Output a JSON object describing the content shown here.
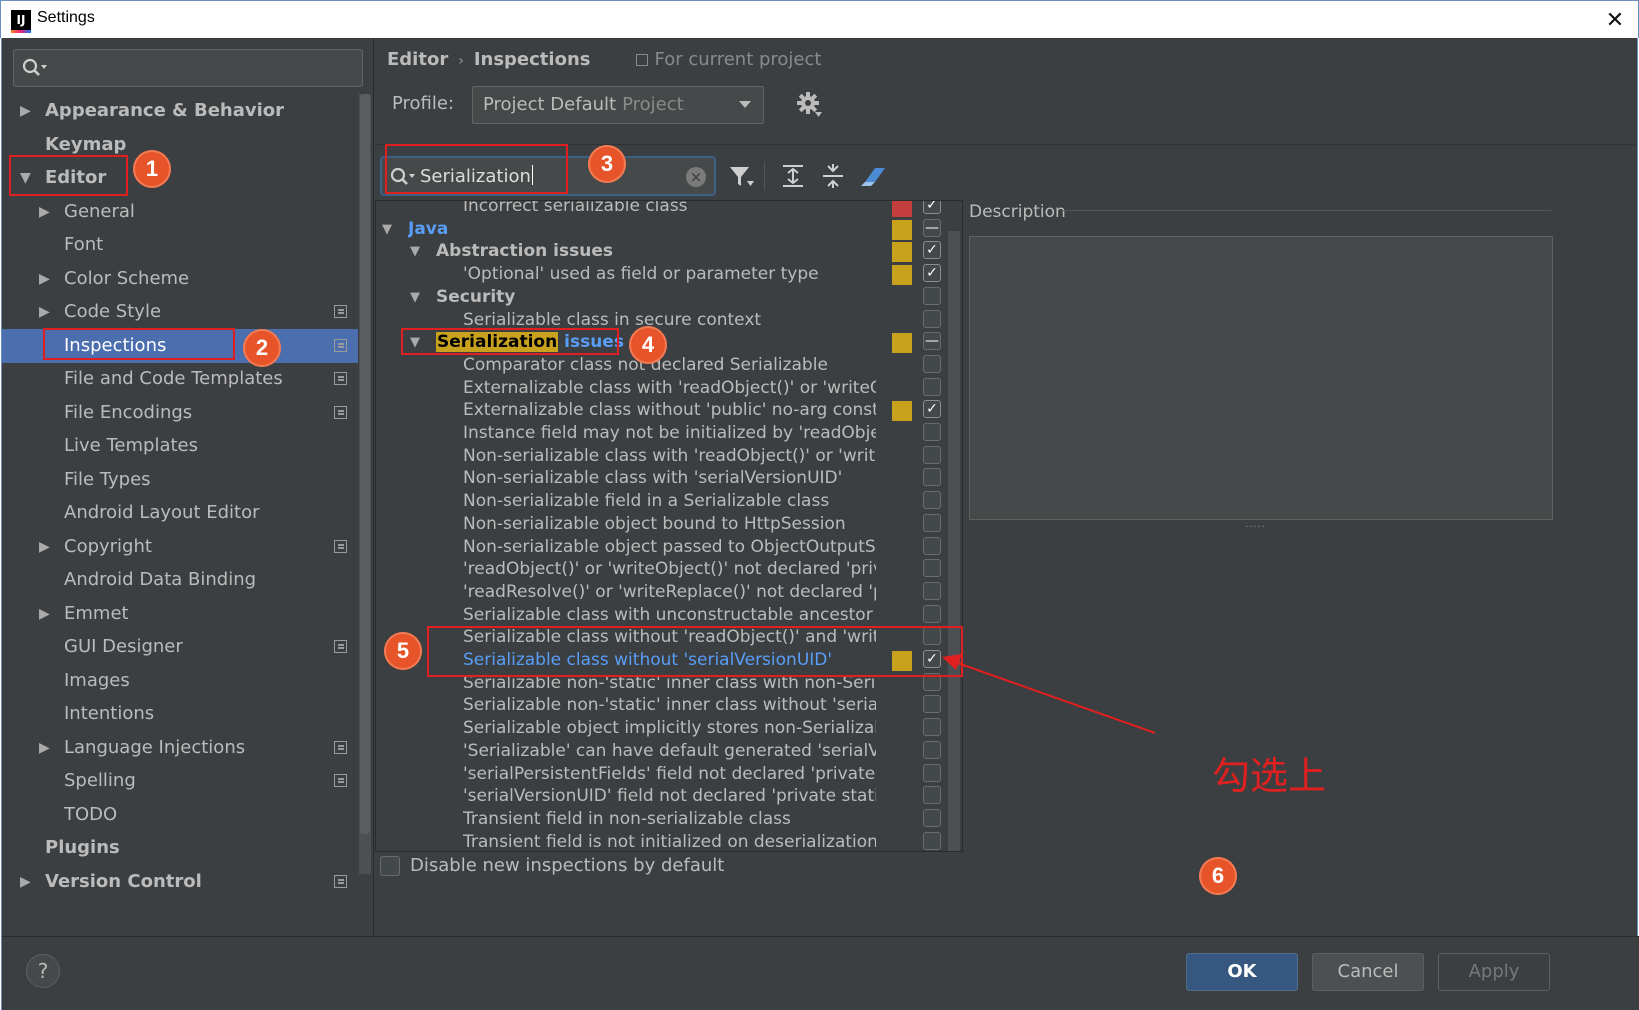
{
  "window": {
    "title": "Settings",
    "close": "✕"
  },
  "sidebar": {
    "items": [
      {
        "label": "Appearance & Behavior",
        "arrow": "▶"
      },
      {
        "label": "Keymap",
        "arrow": ""
      },
      {
        "label": "Editor",
        "arrow": "▼"
      },
      {
        "label": "General",
        "arrow": "▶"
      },
      {
        "label": "Font",
        "arrow": ""
      },
      {
        "label": "Color Scheme",
        "arrow": "▶"
      },
      {
        "label": "Code Style",
        "arrow": "▶"
      },
      {
        "label": "Inspections",
        "arrow": ""
      },
      {
        "label": "File and Code Templates",
        "arrow": ""
      },
      {
        "label": "File Encodings",
        "arrow": ""
      },
      {
        "label": "Live Templates",
        "arrow": ""
      },
      {
        "label": "File Types",
        "arrow": ""
      },
      {
        "label": "Android Layout Editor",
        "arrow": ""
      },
      {
        "label": "Copyright",
        "arrow": "▶"
      },
      {
        "label": "Android Data Binding",
        "arrow": ""
      },
      {
        "label": "Emmet",
        "arrow": "▶"
      },
      {
        "label": "GUI Designer",
        "arrow": ""
      },
      {
        "label": "Images",
        "arrow": ""
      },
      {
        "label": "Intentions",
        "arrow": ""
      },
      {
        "label": "Language Injections",
        "arrow": "▶"
      },
      {
        "label": "Spelling",
        "arrow": ""
      },
      {
        "label": "TODO",
        "arrow": ""
      },
      {
        "label": "Plugins",
        "arrow": ""
      },
      {
        "label": "Version Control",
        "arrow": "▶"
      }
    ]
  },
  "breadcrumb": {
    "parent": "Editor",
    "separator": "›",
    "current": "Inspections",
    "scope": "For current project"
  },
  "profile": {
    "label": "Profile:",
    "value": "Project Default",
    "suffix": "Project"
  },
  "filter": {
    "value": "Serialization"
  },
  "inspections": {
    "rows": [
      {
        "text": "Incorrect serializable class",
        "arrow": ""
      },
      {
        "text": "Java",
        "arrow": "▼"
      },
      {
        "text": "Abstraction issues",
        "arrow": "▼"
      },
      {
        "text": "'Optional' used as field or parameter type",
        "arrow": ""
      },
      {
        "text": "Security",
        "arrow": "▼"
      },
      {
        "text": "Serializable class in secure context",
        "arrow": ""
      },
      {
        "text_hl": "Serialization",
        "text": " issues",
        "arrow": "▼"
      },
      {
        "text": "Comparator class not declared Serializable",
        "arrow": ""
      },
      {
        "text": "Externalizable class with 'readObject()' or 'writeObj",
        "arrow": ""
      },
      {
        "text": "Externalizable class without 'public' no-arg constru",
        "arrow": ""
      },
      {
        "text": "Instance field may not be initialized by 'readObject",
        "arrow": ""
      },
      {
        "text": "Non-serializable class with 'readObject()' or 'writeO",
        "arrow": ""
      },
      {
        "text": "Non-serializable class with 'serialVersionUID'",
        "arrow": ""
      },
      {
        "text": "Non-serializable field in a Serializable class",
        "arrow": ""
      },
      {
        "text": "Non-serializable object bound to HttpSession",
        "arrow": ""
      },
      {
        "text": "Non-serializable object passed to ObjectOutputStr",
        "arrow": ""
      },
      {
        "text": "'readObject()' or 'writeObject()' not declared 'privat",
        "arrow": ""
      },
      {
        "text": "'readResolve()' or 'writeReplace()' not declared 'pro",
        "arrow": ""
      },
      {
        "text": "Serializable class with unconstructable ancestor",
        "arrow": ""
      },
      {
        "text": "Serializable class without 'readObject()' and 'writeC",
        "arrow": ""
      },
      {
        "text": "Serializable class without 'serialVersionUID'",
        "arrow": ""
      },
      {
        "text": "Serializable non-'static' inner class with non-Serializ",
        "arrow": ""
      },
      {
        "text": "Serializable non-'static' inner class without 'serialVe",
        "arrow": ""
      },
      {
        "text": "Serializable object implicitly stores non-Serializable",
        "arrow": ""
      },
      {
        "text": "'Serializable' can have default generated 'serialVers",
        "arrow": ""
      },
      {
        "text": "'serialPersistentFields' field not declared 'private sta",
        "arrow": ""
      },
      {
        "text": "'serialVersionUID' field not declared 'private static f",
        "arrow": ""
      },
      {
        "text": "Transient field in non-serializable class",
        "arrow": ""
      },
      {
        "text": "Transient field is not initialized on deserialization",
        "arrow": ""
      }
    ]
  },
  "description": {
    "label": "Description",
    "grip": "·····"
  },
  "options": {
    "disable_new": "Disable new inspections by default"
  },
  "footer": {
    "help": "?",
    "ok": "OK",
    "cancel": "Cancel",
    "apply": "Apply"
  },
  "annotations": {
    "badges": [
      "1",
      "2",
      "3",
      "4",
      "5",
      "6"
    ],
    "note": "勾选上"
  },
  "colors": {
    "background": "#3c3f41",
    "selection": "#4b6eaf",
    "link_blue": "#589df6",
    "warning_severity": "#c8a21d",
    "error_severity": "#c43e3e",
    "annotation_red": "#e02020",
    "badge_orange": "#e8542a"
  }
}
